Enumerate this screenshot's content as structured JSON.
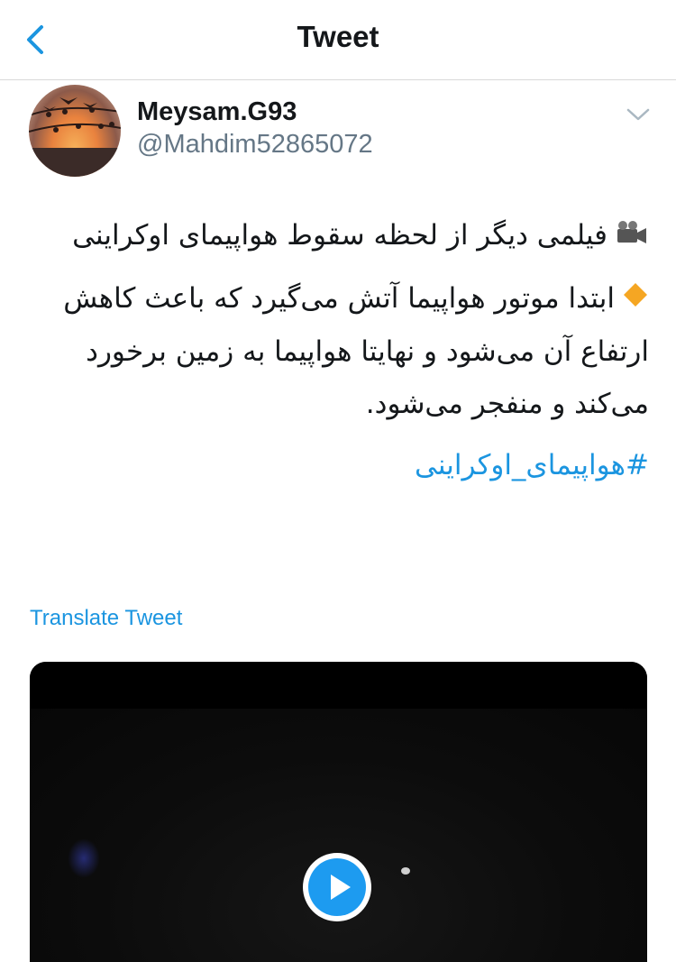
{
  "header": {
    "title": "Tweet"
  },
  "author": {
    "display_name": "Meysam.G93",
    "handle": "@Mahdim52865072"
  },
  "tweet": {
    "line1": "فیلمی دیگر از لحظه سقوط هواپیمای اوکراینی",
    "line2": "ابتدا موتور هواپیما آتش می‌گیرد که باعث کاهش ارتفاع آن می‌شود و نهایتا هواپیما به زمین برخورد می‌کند و منفجر می‌شود.",
    "hashtag": "#هواپیمای_اوکراینی",
    "emoji1": "movie-camera-icon",
    "emoji2": "orange-diamond-icon"
  },
  "actions": {
    "translate": "Translate Tweet"
  },
  "colors": {
    "link": "#1b95e0",
    "play": "#1d9bf0",
    "secondary_text": "#657786"
  }
}
